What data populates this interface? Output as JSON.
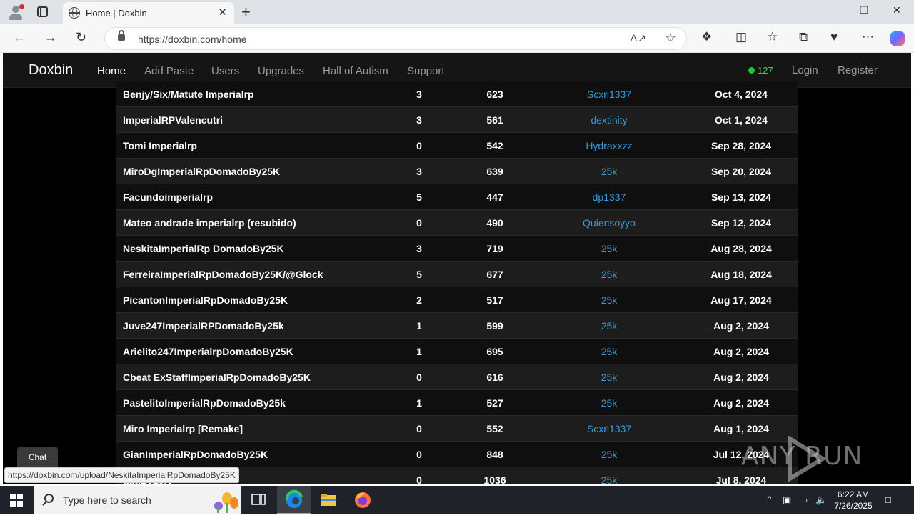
{
  "browser": {
    "tab_title": "Home | Doxbin",
    "url": "https://doxbin.com/home",
    "new_tab": "+",
    "close_tab": "✕"
  },
  "site": {
    "brand": "Doxbin",
    "nav": [
      "Home",
      "Add Paste",
      "Users",
      "Upgrades",
      "Hall of Autism",
      "Support"
    ],
    "online_count": "127",
    "login": "Login",
    "register": "Register"
  },
  "pastes": [
    {
      "title": "Benjy/Six/Matute Imperialrp",
      "comments": "3",
      "views": "623",
      "user": "Scxrl1337",
      "date": "Oct 4, 2024"
    },
    {
      "title": "ImperialRPValencutri",
      "comments": "3",
      "views": "561",
      "user": "dextinity",
      "date": "Oct 1, 2024"
    },
    {
      "title": "Tomi Imperialrp",
      "comments": "0",
      "views": "542",
      "user": "Hydraxxzz",
      "date": "Sep 28, 2024"
    },
    {
      "title": "MiroDgImperialRpDomadoBy25K",
      "comments": "3",
      "views": "639",
      "user": "25k",
      "date": "Sep 20, 2024"
    },
    {
      "title": "Facundoimperialrp",
      "comments": "5",
      "views": "447",
      "user": "dp1337",
      "date": "Sep 13, 2024"
    },
    {
      "title": "Mateo andrade imperialrp (resubido)",
      "comments": "0",
      "views": "490",
      "user": "Quiensoyyo",
      "date": "Sep 12, 2024"
    },
    {
      "title": "NeskitaImperialRp DomadoBy25K",
      "comments": "3",
      "views": "719",
      "user": "25k",
      "date": "Aug 28, 2024"
    },
    {
      "title": "FerreiraImperialRpDomadoBy25K/@Glock",
      "comments": "5",
      "views": "677",
      "user": "25k",
      "date": "Aug 18, 2024"
    },
    {
      "title": "PicantonImperialRpDomadoBy25K",
      "comments": "2",
      "views": "517",
      "user": "25k",
      "date": "Aug 17, 2024"
    },
    {
      "title": "Juve247ImperialRPDomadoBy25k",
      "comments": "1",
      "views": "599",
      "user": "25k",
      "date": "Aug 2, 2024"
    },
    {
      "title": "Arielito247ImperialrpDomadoBy25K",
      "comments": "1",
      "views": "695",
      "user": "25k",
      "date": "Aug 2, 2024"
    },
    {
      "title": "Cbeat ExStaffImperialRpDomadoBy25K",
      "comments": "0",
      "views": "616",
      "user": "25k",
      "date": "Aug 2, 2024"
    },
    {
      "title": "PastelitoImperialRpDomadoBy25k",
      "comments": "1",
      "views": "527",
      "user": "25k",
      "date": "Aug 2, 2024"
    },
    {
      "title": "Miro Imperialrp [Remake]",
      "comments": "0",
      "views": "552",
      "user": "Scxrl1337",
      "date": "Aug 1, 2024"
    },
    {
      "title": "GianImperialRpDomadoBy25K",
      "comments": "0",
      "views": "848",
      "user": "25k",
      "date": "Jul 12, 2024"
    },
    {
      "title": "adaBy25K",
      "comments": "0",
      "views": "1036",
      "user": "25k",
      "date": "Jul 8, 2024"
    }
  ],
  "chat_label": "Chat",
  "status_url": "https://doxbin.com/upload/NeskitaImperialRpDomadoBy25K",
  "watermark": "ANY RUN",
  "taskbar": {
    "search_placeholder": "Type here to search",
    "time": "6:22 AM",
    "date": "7/26/2025"
  }
}
